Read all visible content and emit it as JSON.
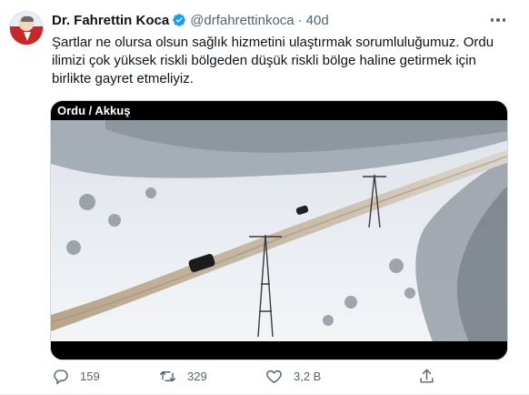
{
  "author": {
    "name": "Dr. Fahrettin Koca",
    "handle": "@drfahrettinkoca",
    "separator": "·",
    "time": "40d"
  },
  "tweet": {
    "lines": [
      "Şartlar ne olursa olsun sağlık hizmetini ulaştırmak sorumluluğumuz. Ordu",
      "ilimizi çok yüksek riskli bölgeden düşük riskli bölge haline getirmek için",
      "birlikte gayret etmeliyiz."
    ]
  },
  "media": {
    "label": "Ordu / Akkuş"
  },
  "actions": {
    "reply_count": "159",
    "retweet_count": "329",
    "like_count": "3,2 B"
  },
  "colors": {
    "verified": "#1d9bf0",
    "secondary_text": "#536471",
    "primary_text": "#0f1419"
  },
  "icons": {
    "verified": "verified-badge-icon",
    "more": "more-options-icon",
    "reply": "reply-icon",
    "retweet": "retweet-icon",
    "like": "heart-icon",
    "share": "share-icon"
  }
}
